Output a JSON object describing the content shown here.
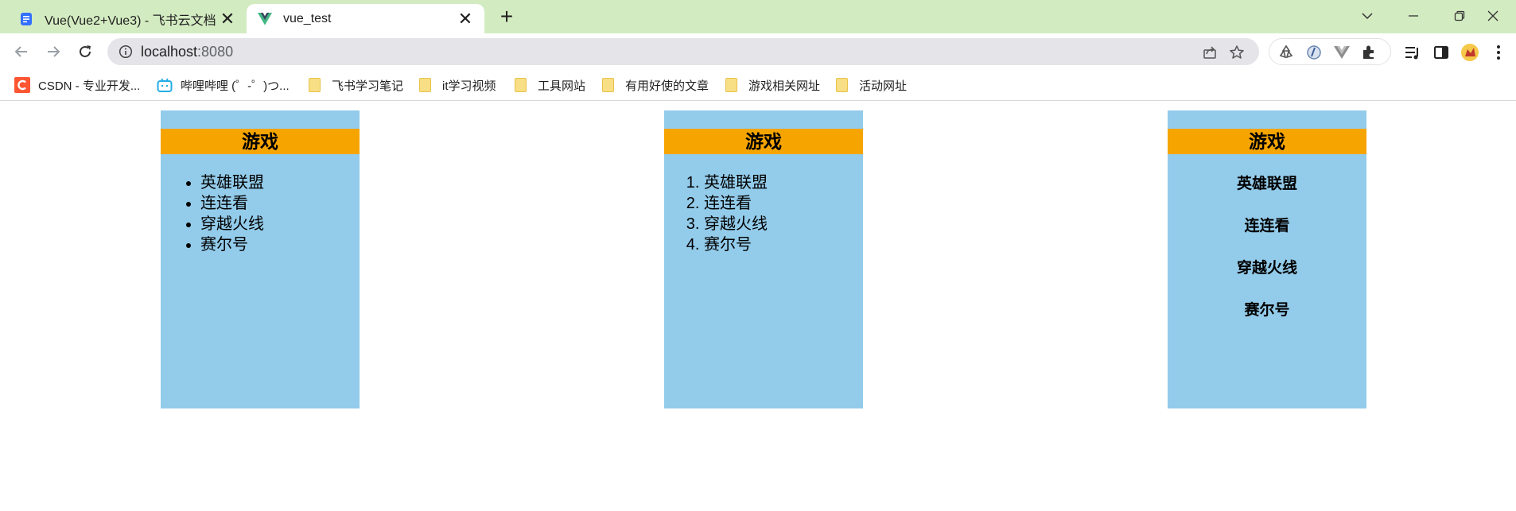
{
  "tabs": [
    {
      "title": "Vue(Vue2+Vue3) - 飞书云文档",
      "active": false,
      "icon": "doc-icon"
    },
    {
      "title": "vue_test",
      "active": true,
      "icon": "vue-logo-icon"
    }
  ],
  "address": {
    "host": "localhost",
    "port": ":8080"
  },
  "bookmarks": [
    {
      "label": "CSDN - 专业开发...",
      "icon": "csdn-icon"
    },
    {
      "label": "哔哩哔哩 (゜-゜)つ...",
      "icon": "bilibili-icon"
    },
    {
      "label": "飞书学习笔记",
      "icon": "folder-icon"
    },
    {
      "label": "it学习视频",
      "icon": "folder-icon"
    },
    {
      "label": "工具网站",
      "icon": "folder-icon"
    },
    {
      "label": "有用好使的文章",
      "icon": "folder-icon"
    },
    {
      "label": "游戏相关网址",
      "icon": "folder-icon"
    },
    {
      "label": "活动网址",
      "icon": "folder-icon"
    }
  ],
  "cards": [
    {
      "title": "游戏",
      "list_type": "unordered",
      "items": [
        "英雄联盟",
        "连连看",
        "穿越火线",
        "赛尔号"
      ]
    },
    {
      "title": "游戏",
      "list_type": "ordered",
      "items": [
        "英雄联盟",
        "连连看",
        "穿越火线",
        "赛尔号"
      ]
    },
    {
      "title": "游戏",
      "list_type": "heading-list",
      "items": [
        "英雄联盟",
        "连连看",
        "穿越火线",
        "赛尔号"
      ]
    }
  ],
  "colors": {
    "tabstrip": "#d3ebc1",
    "card_bg": "#93cbea",
    "card_title_bg": "#f6a400"
  }
}
